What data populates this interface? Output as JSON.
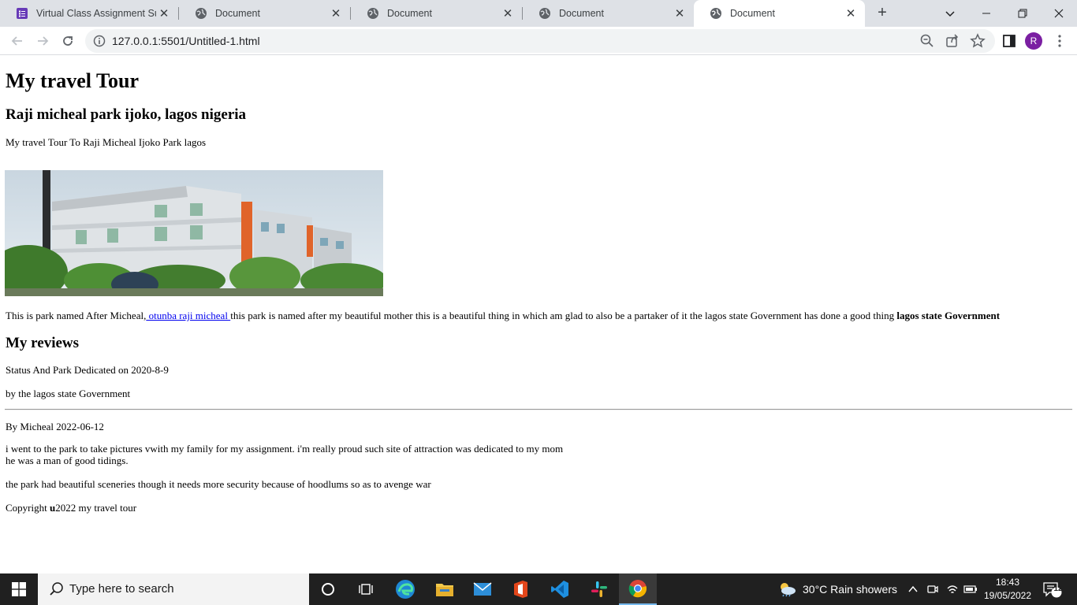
{
  "browser": {
    "tabs": [
      {
        "label": "Virtual Class Assignment Sub",
        "icon": "forms-icon"
      },
      {
        "label": "Document",
        "icon": "globe-icon"
      },
      {
        "label": "Document",
        "icon": "globe-icon"
      },
      {
        "label": "Document",
        "icon": "globe-icon"
      },
      {
        "label": "Document",
        "icon": "globe-icon",
        "active": true
      }
    ],
    "url": "127.0.0.1:5501/Untitled-1.html",
    "profile_initial": "R"
  },
  "page": {
    "title": "My travel Tour",
    "subtitle": "Raji micheal park ijoko, lagos nigeria",
    "intro": "My travel Tour To Raji Micheal Ijoko Park lagos",
    "description": {
      "before": "This is park named After Micheal,",
      "link": " otunba raji micheal ",
      "after": "this park is named after my beautiful mother this is a beautiful thing in which am glad to also be a partaker of it the lagos state Government has done a good thing ",
      "bold": "lagos state Government"
    },
    "reviews_heading": "My reviews",
    "dedicated": "Status And Park Dedicated on 2020-8-9",
    "by_govt": "by the lagos state Government",
    "review_author": "By Micheal 2022-06-12",
    "review_line1": "i went to the park to take pictures vwith my family for my assignment. i'm really proud such site of attraction was dedicated to my mom",
    "review_line2": "he was a man of good tidings.",
    "review_line3": "the park had beautiful sceneries though it needs more security because of hoodlums so as to avenge war",
    "copyright_prefix": "Copyright ",
    "copyright_bold": "u",
    "copyright_suffix": "2022 my travel tour"
  },
  "taskbar": {
    "search_placeholder": "Type here to search",
    "weather": "30°C  Rain showers",
    "time": "18:43",
    "date": "19/05/2022",
    "notifications": "12"
  },
  "colors": {
    "tab_strip": "#dee1e6",
    "link": "#0000ee",
    "taskbar": "#202020",
    "avatar": "#7b1fa2"
  }
}
